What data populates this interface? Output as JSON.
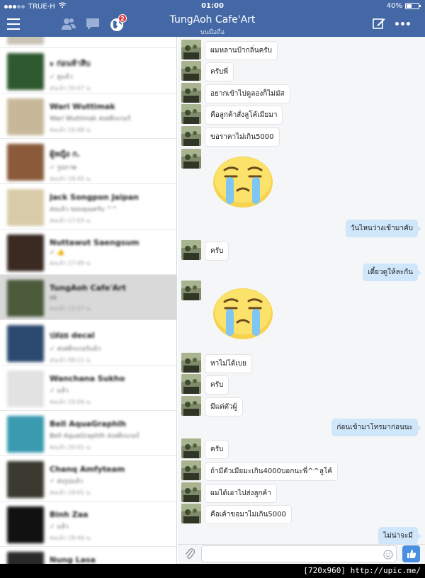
{
  "status_bar": {
    "carrier": "TRUE-H",
    "time": "01:00",
    "battery_percent": "40%",
    "battery_level": 0.4
  },
  "nav": {
    "title": "TungAoh Cafe'Art",
    "subtitle": "บนมือถือ",
    "notification_badge": "2",
    "icons": [
      "menu-icon",
      "friends-icon",
      "messages-icon",
      "globe-icon",
      "compose-icon",
      "more-icon"
    ]
  },
  "sidebar": {
    "contacts": [
      {
        "name": "",
        "preview": "",
        "meta": "ส่งแล้ว 14:48 น.",
        "avatar_color": "#c9c3b6",
        "partial": true
      },
      {
        "name": "ะ ก่อนห้าสิบ",
        "preview": "✓ ดูแล้ว",
        "meta": "ส่งแล้ว 20:47 น.",
        "avatar_color": "#2f5a2f"
      },
      {
        "name": "Wari Wuttimak",
        "preview": "Wari Wuttimak ส่งสติกเกอร์",
        "meta": "ส่งแล้ว 10:48 น.",
        "avatar_color": "#c8b89a"
      },
      {
        "name": "ผู้หญิง ก.",
        "preview": "✓ รูปภาพ",
        "meta": "ส่งแล้ว 18:45 น.",
        "avatar_color": "#8a5a3a"
      },
      {
        "name": "Jack Songpon Jaipan",
        "preview": "ส่งแล้ว ขอบคุณครับ ^^",
        "meta": "ส่งแล้ว 17:03 น.",
        "avatar_color": "#d8cba8"
      },
      {
        "name": "Nuttawut Saengsum",
        "preview": "✓ 👍",
        "meta": "ส่งแล้ว 17:49 น.",
        "avatar_color": "#3a2a22"
      },
      {
        "name": "TungAoh Cafe'Art",
        "preview": "ok",
        "meta": "ส่งแล้ว 12:57 น.",
        "avatar_color": "#4a5a3a",
        "active": true
      },
      {
        "name": "ปล่อย decal",
        "preview": "✓ ส่งสติกเกอร์แล้ว",
        "meta": "ส่งแล้ว 09:11 น.",
        "avatar_color": "#2c4a70"
      },
      {
        "name": "Wanchana Sukho",
        "preview": "✓ แล้ว",
        "meta": "ส่งแล้ว 19:04 น.",
        "avatar_color": "#e2e2e2"
      },
      {
        "name": "Bell AquaGraphlh",
        "preview": "Bell AquaGraphlh ส่งสติกเกอร์",
        "meta": "ส่งแล้ว 20:01 น.",
        "avatar_color": "#3a9ab0"
      },
      {
        "name": "Chanq Amfyteam",
        "preview": "✓ ส่งรูปแล้ว",
        "meta": "ส่งแล้ว 19:01 น.",
        "avatar_color": "#3a3a30"
      },
      {
        "name": "Binh Zaa",
        "preview": "✓ แล้ว",
        "meta": "ส่งแล้ว 18:44 น.",
        "avatar_color": "#111111"
      },
      {
        "name": "Nung Lasa",
        "preview": "",
        "meta": "",
        "avatar_color": "#2a2a2a",
        "partial": true
      }
    ]
  },
  "messages": [
    {
      "dir": "in",
      "text": "ผมหลานป้ากลิ่นครับ"
    },
    {
      "dir": "in",
      "text": "ครับพี่"
    },
    {
      "dir": "in",
      "text": "อยากเข้าไปดูลองก็ไม่มัส"
    },
    {
      "dir": "in",
      "text": "คือลูกค้าสั่งลูโค้เมียมา"
    },
    {
      "dir": "in",
      "text": "ขอราคาไม่เกิน5000"
    },
    {
      "dir": "in",
      "text": "",
      "sticker": "crying-face-sticker"
    },
    {
      "dir": "out",
      "text": "วันไหนว่างเข้ามาคับ"
    },
    {
      "dir": "in",
      "text": "ครับ"
    },
    {
      "dir": "out",
      "text": "เดี๋ยวดูให้ละกัน"
    },
    {
      "dir": "in",
      "text": "",
      "sticker": "crying-face-sticker"
    },
    {
      "dir": "in",
      "text": "หาไม่ได้เบย"
    },
    {
      "dir": "in",
      "text": "ครับ"
    },
    {
      "dir": "in",
      "text": "มีแต่ตัวผู้"
    },
    {
      "dir": "out",
      "text": "ก่อนเข้ามาโทรมาก่อนนะ"
    },
    {
      "dir": "in",
      "text": "ครับ"
    },
    {
      "dir": "in",
      "text": "ถ้ามีตัวเมียมะเกิน4000บอกนะพี่^^ลูโค้"
    },
    {
      "dir": "in",
      "text": "ผมได้เอาไปส่งลูกค้า"
    },
    {
      "dir": "in",
      "text": "คือเค้าขอมาไม่เกิน5000"
    },
    {
      "dir": "out",
      "text": "ไม่น่าจะมี"
    }
  ],
  "composer": {
    "placeholder": "",
    "icons": [
      "attach-icon",
      "emoji-icon",
      "like-icon"
    ]
  },
  "watermark": "[720x960] http://upic.me/",
  "colors": {
    "nav": "#4468a6",
    "outgoing_bubble": "#cfe6fb",
    "like_button": "#4a90e2",
    "badge": "#e0333a"
  }
}
